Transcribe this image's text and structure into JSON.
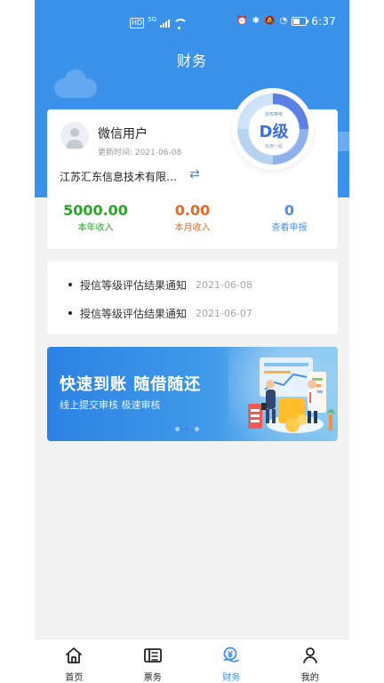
{
  "status_bar": {
    "hd_badge": "HD",
    "network_small": "5G",
    "time": "6:37",
    "battery_level": 0.55
  },
  "header": {
    "title": "财务"
  },
  "profile": {
    "name": "微信用户",
    "updated_at": "更新时间: 2021-06-08",
    "company": "江苏汇东信息技术有限…",
    "metrics": [
      {
        "value": "5000.00",
        "label": "本年收入",
        "color": "#2aa52a"
      },
      {
        "value": "0.00",
        "label": "本月收入",
        "color": "#e16a2b"
      },
      {
        "value": "0",
        "label": "查看申报",
        "color": "#4f90df"
      }
    ],
    "grade": {
      "title": "授权等级",
      "value": "D级",
      "note": "信用一般"
    }
  },
  "notices": [
    {
      "title": "授信等级评估结果通知",
      "date": "2021-06-08"
    },
    {
      "title": "授信等级评估结果通知",
      "date": "2021-06-07"
    }
  ],
  "banner": {
    "title": "快速到账 随借随还",
    "subtitle": "线上提交审核   极速审核",
    "carousel_active_index": 2
  },
  "tabbar": {
    "items": [
      {
        "label": "首页",
        "icon": "home-icon"
      },
      {
        "label": "票务",
        "icon": "ticket-icon"
      },
      {
        "label": "财务",
        "icon": "finance-icon",
        "active": true
      },
      {
        "label": "我的",
        "icon": "user-icon"
      }
    ],
    "active_color": "#3f8fe9"
  },
  "colors": {
    "primary_blue": "#3a92ea",
    "page_background": "#f2f2f2",
    "card_background": "#ffffff"
  }
}
